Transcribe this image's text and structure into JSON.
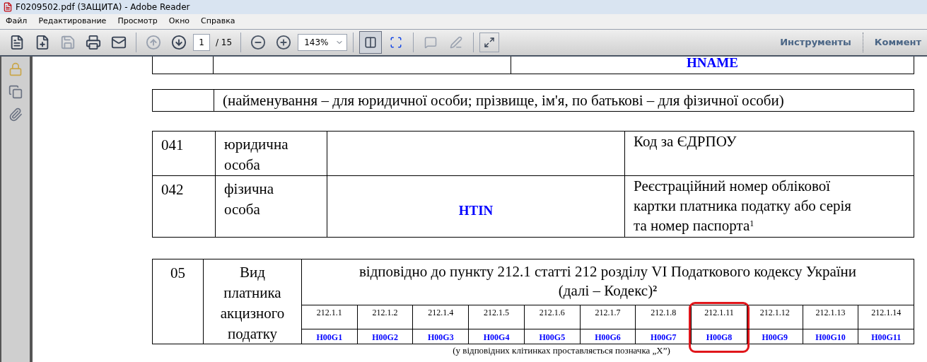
{
  "window": {
    "title": "F0209502.pdf (ЗАЩИТА) - Adobe Reader"
  },
  "menu": [
    "Файл",
    "Редактирование",
    "Просмотр",
    "Окно",
    "Справка"
  ],
  "toolbar": {
    "left_buttons": [
      {
        "kind": "open",
        "disabled": false
      },
      {
        "kind": "create",
        "disabled": false
      },
      {
        "kind": "save",
        "disabled": true
      },
      {
        "kind": "print",
        "disabled": false
      },
      {
        "kind": "email",
        "disabled": false
      }
    ],
    "nav_buttons": [
      {
        "kind": "prev",
        "disabled": true
      },
      {
        "kind": "next",
        "disabled": false
      }
    ],
    "page": "1",
    "page_total": "/ 15",
    "zoom": "143%",
    "tools": [
      "Инструменты",
      "Коммент"
    ]
  },
  "document": {
    "name_table": {
      "value": "HNAME"
    },
    "name_caption": "(найменування – для юридичної особи; прізвище, ім'я, по батькові – для фізичної особи)",
    "id_rows": [
      {
        "code": "041",
        "type": "юридична особа",
        "value": "",
        "label": "Код за ЄДРПОУ"
      },
      {
        "code": "042",
        "type": "фізична особа",
        "value": "HTIN",
        "label": "Реєстраційний номер облікової картки платника податку або серія та номер паспорта$^{1}$"
      }
    ],
    "kind_table": {
      "code": "05",
      "title": "Вид платника акцизного податку",
      "header": "відповідно до пункту 212.1 статті 212 розділу VI Податкового кодексу України (далі – Кодекс)$^{2}$",
      "items": [
        {
          "point": "212.1.1",
          "field": "H00G1",
          "highlighted": false
        },
        {
          "point": "212.1.2",
          "field": "H00G2",
          "highlighted": false
        },
        {
          "point": "212.1.4",
          "field": "H00G3",
          "highlighted": false
        },
        {
          "point": "212.1.5",
          "field": "H00G4",
          "highlighted": false
        },
        {
          "point": "212.1.6",
          "field": "H00G5",
          "highlighted": false
        },
        {
          "point": "212.1.7",
          "field": "H00G6",
          "highlighted": false
        },
        {
          "point": "212.1.8",
          "field": "H00G7",
          "highlighted": false
        },
        {
          "point": "212.1.11",
          "field": "H00G8",
          "highlighted": true
        },
        {
          "point": "212.1.12",
          "field": "H00G9",
          "highlighted": false
        },
        {
          "point": "212.1.13",
          "field": "H00G10",
          "highlighted": false
        },
        {
          "point": "212.1.14",
          "field": "H00G11",
          "highlighted": false
        }
      ],
      "note": "(у відповідних клітинках проставляється позначка „X”)"
    }
  }
}
